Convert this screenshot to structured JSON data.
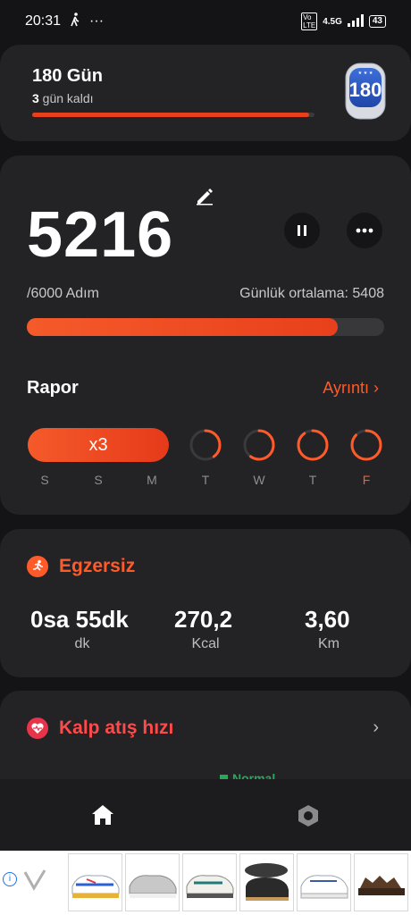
{
  "status_bar": {
    "time": "20:31",
    "network": "4.5G",
    "battery": "43",
    "more": "···"
  },
  "challenge": {
    "title": "180 Gün",
    "days_left_number": "3",
    "days_left_text": " gün kaldı",
    "progress": 0.98,
    "badge_text": "180"
  },
  "steps": {
    "count": "5216",
    "goal": "/6000 Adım",
    "daily_average": "Günlük ortalama: 5408",
    "progress": 0.87
  },
  "report": {
    "title": "Rapor",
    "detail": "Ayrıntı",
    "streak_label": "x3",
    "days": [
      {
        "letter": "S",
        "progress": 1.0
      },
      {
        "letter": "S",
        "progress": 1.0
      },
      {
        "letter": "M",
        "progress": 1.0
      },
      {
        "letter": "T",
        "progress": 0.4
      },
      {
        "letter": "W",
        "progress": 0.6
      },
      {
        "letter": "T",
        "progress": 0.9
      },
      {
        "letter": "F",
        "progress": 0.87
      }
    ]
  },
  "exercise": {
    "title": "Egzersiz",
    "stats": [
      {
        "value": "0sa 55dk",
        "unit": "dk"
      },
      {
        "value": "270,2",
        "unit": "Kcal"
      },
      {
        "value": "3,60",
        "unit": "Km"
      }
    ]
  },
  "heart": {
    "title": "Kalp atış hızı",
    "status": "Normal"
  },
  "colors": {
    "accent": "#ff5a2a",
    "card": "#232326",
    "background": "#141416"
  }
}
